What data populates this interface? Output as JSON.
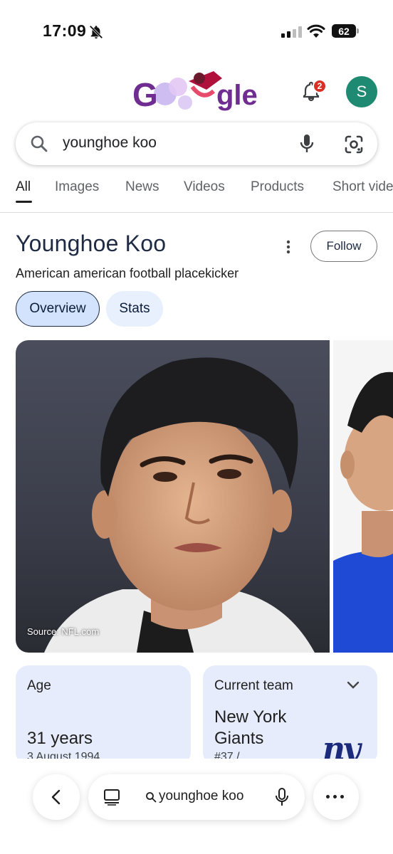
{
  "status_bar": {
    "time": "17:09",
    "battery": "62",
    "icons": [
      "bell-off-icon",
      "signal-icon",
      "wifi-icon",
      "battery-icon"
    ]
  },
  "header": {
    "logo_text": "Google",
    "notification_count": "2",
    "avatar_letter": "S",
    "avatar_color": "#1e8a72"
  },
  "search": {
    "query": "younghoe koo"
  },
  "tabs": [
    {
      "label": "All",
      "active": true
    },
    {
      "label": "Images"
    },
    {
      "label": "News"
    },
    {
      "label": "Videos"
    },
    {
      "label": "Products"
    },
    {
      "label": "Short vide"
    }
  ],
  "knowledge_panel": {
    "title": "Younghoe Koo",
    "subtitle": "American american football placekicker",
    "follow_label": "Follow",
    "chips": [
      "Overview",
      "Stats"
    ],
    "photo_source": "Source: NFL.com"
  },
  "cards": {
    "age": {
      "label": "Age",
      "value": "31 years",
      "sub": "3 August 1994"
    },
    "team": {
      "label": "Current team",
      "value_line1": "New York",
      "value_line2": "Giants",
      "sub": "#37 /",
      "logo_text": "ny"
    }
  },
  "bottom_bar": {
    "query": "younghoe koo"
  },
  "colors": {
    "accent": "#d3e3fd",
    "card_bg": "#e6ecfb",
    "badge": "#d93025"
  }
}
